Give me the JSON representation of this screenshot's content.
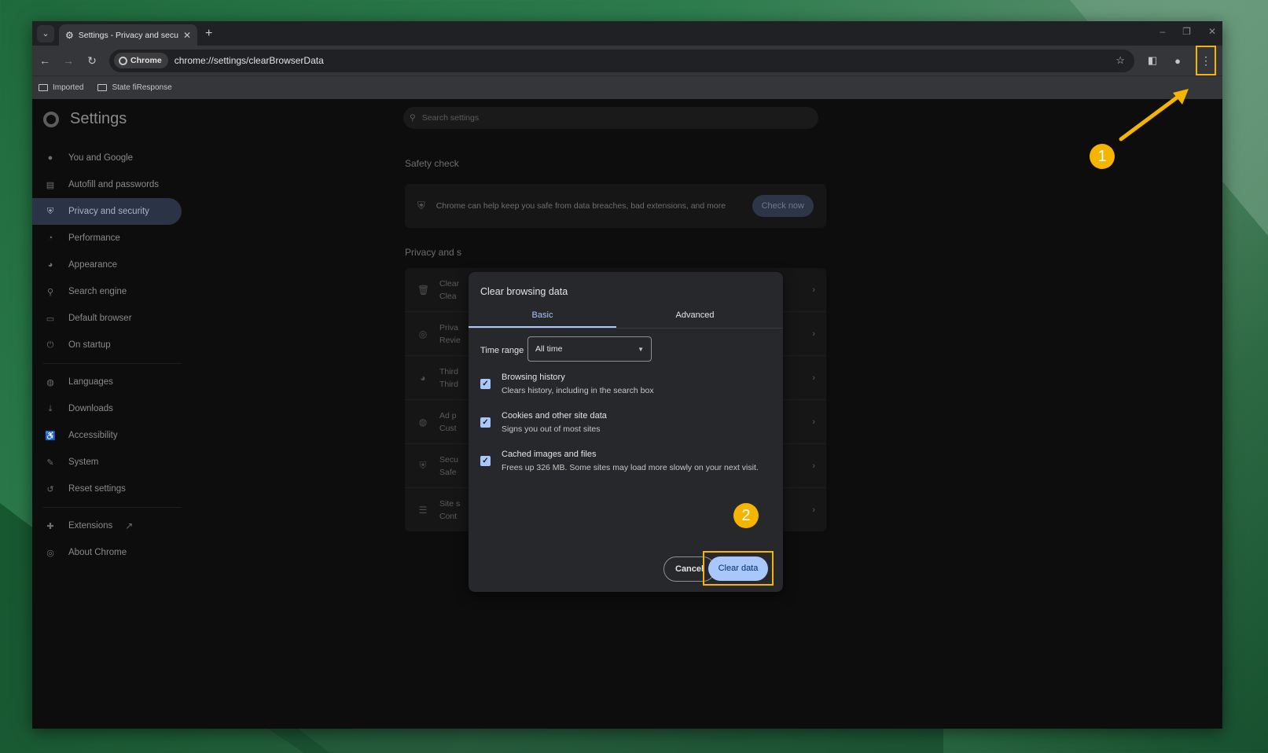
{
  "browser": {
    "tab_title": "Settings - Privacy and security",
    "new_tab_icon": "plus-icon",
    "url_chip": "Chrome",
    "url": "chrome://settings/clearBrowserData",
    "bookmarks": [
      "Imported",
      "State fiResponse"
    ]
  },
  "settings": {
    "title": "Settings",
    "search_placeholder": "Search settings",
    "sidebar": [
      {
        "label": "You and Google",
        "icon": "person-icon"
      },
      {
        "label": "Autofill and passwords",
        "icon": "clipboard-icon"
      },
      {
        "label": "Privacy and security",
        "icon": "shield-icon",
        "active": true
      },
      {
        "label": "Performance",
        "icon": "gauge-icon"
      },
      {
        "label": "Appearance",
        "icon": "palette-icon"
      },
      {
        "label": "Search engine",
        "icon": "search-icon"
      },
      {
        "label": "Default browser",
        "icon": "browser-icon"
      },
      {
        "label": "On startup",
        "icon": "power-icon"
      },
      {
        "label": "Languages",
        "icon": "globe-icon"
      },
      {
        "label": "Downloads",
        "icon": "download-icon"
      },
      {
        "label": "Accessibility",
        "icon": "accessibility-icon"
      },
      {
        "label": "System",
        "icon": "wrench-icon"
      },
      {
        "label": "Reset settings",
        "icon": "reset-icon"
      },
      {
        "label": "Extensions",
        "icon": "puzzle-icon"
      },
      {
        "label": "About Chrome",
        "icon": "chrome-icon"
      }
    ],
    "safety_check_label": "Safety check",
    "safety_text": "Chrome can help keep you safe from data breaches, bad extensions, and more",
    "check_now": "Check now",
    "privacy_label": "Privacy and s",
    "privacy_rows": [
      {
        "line1": "Clear",
        "line2": "Clea"
      },
      {
        "line1": "Priva",
        "line2": "Revie"
      },
      {
        "line1": "Third",
        "line2": "Third"
      },
      {
        "line1": "Ad p",
        "line2": "Cust"
      },
      {
        "line1": "Secu",
        "line2": "Safe"
      },
      {
        "line1": "Site s",
        "line2": "Cont"
      }
    ]
  },
  "dialog": {
    "title": "Clear browsing data",
    "tab_basic": "Basic",
    "tab_advanced": "Advanced",
    "time_range_label": "Time range",
    "time_range_value": "All time",
    "options": [
      {
        "title": "Browsing history",
        "subtitle": "Clears history, including in the search box",
        "checked": true
      },
      {
        "title": "Cookies and other site data",
        "subtitle": "Signs you out of most sites",
        "checked": true
      },
      {
        "title": "Cached images and files",
        "subtitle": "Frees up 326 MB. Some sites may load more slowly on your next visit.",
        "checked": true
      }
    ],
    "cancel": "Cancel",
    "clear_data": "Clear data"
  },
  "annotations": {
    "badge1": "1",
    "badge2": "2",
    "highlight_color": "#f5b400"
  }
}
